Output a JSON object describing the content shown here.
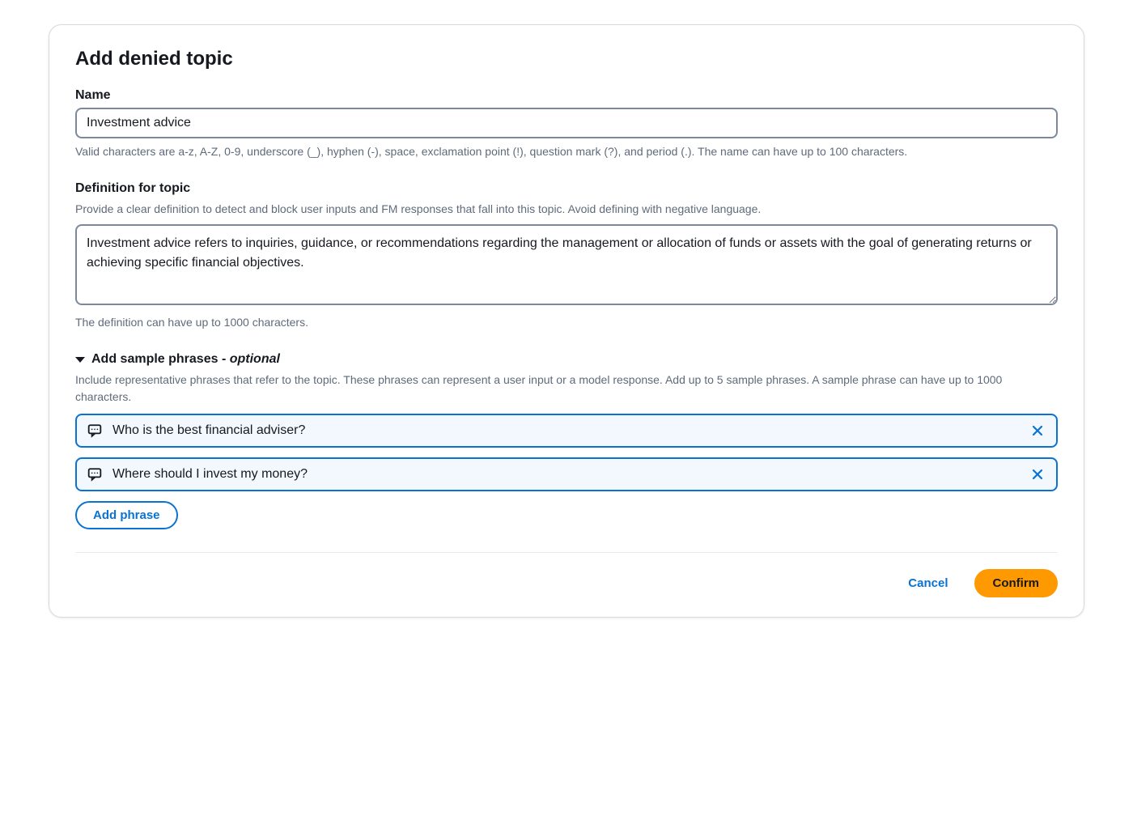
{
  "modal": {
    "title": "Add denied topic",
    "name_field": {
      "label": "Name",
      "value": "Investment advice",
      "helper": "Valid characters are a-z, A-Z, 0-9, underscore (_), hyphen (-), space, exclamation point (!), question mark (?), and period (.). The name can have up to 100 characters."
    },
    "definition_field": {
      "label": "Definition for topic",
      "helper_above": "Provide a clear definition to detect and block user inputs and FM responses that fall into this topic. Avoid defining with negative language.",
      "value": "Investment advice refers to inquiries, guidance, or recommendations regarding the management or allocation of funds or assets with the goal of generating returns or achieving specific financial objectives.",
      "helper_below": "The definition can have up to 1000 characters."
    },
    "sample_phrases": {
      "title_main": "Add sample phrases - ",
      "title_optional": "optional",
      "helper": "Include representative phrases that refer to the topic. These phrases can represent a user input or a model response. Add up to 5 sample phrases. A sample phrase can have up to 1000 characters.",
      "phrases": [
        "Who is the best financial adviser?",
        "Where should I invest my money?"
      ],
      "add_button": "Add phrase"
    },
    "footer": {
      "cancel": "Cancel",
      "confirm": "Confirm"
    }
  }
}
